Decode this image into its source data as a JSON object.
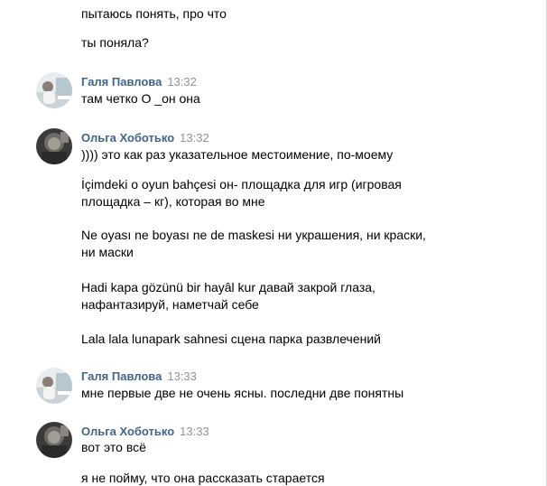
{
  "messages": {
    "pre1": "пытаюсь понять, про что",
    "pre2": "ты поняла?",
    "m1": {
      "author": "Галя Павлова",
      "time": "13:32",
      "text1": "там четко О _он она"
    },
    "m2": {
      "author": "Ольга Хоботько",
      "time": "13:32",
      "text1": ")))) это как раз указательное местоимение, по-моему",
      "text2": "İçimdeki o oyun bahçesi он- площадка для игр (игровая",
      "text3": "площадка – кг), которая во мне",
      "text4": "Ne oyası ne boyası ne de maskesi ни украшения, ни краски,",
      "text5": "ни маски",
      "text6": "Hadi kapa gözünü bir hayâl kur давай закрой глаза,",
      "text7": "нафантазируй, наметчай себе",
      "text8": "Lala lala lunapark sahnesi сцена парка развлечений"
    },
    "m3": {
      "author": "Галя Павлова",
      "time": "13:33",
      "text1": "мне первые две не очень ясны. последни две понятны"
    },
    "m4": {
      "author": "Ольга Хоботько",
      "time": "13:33",
      "text1": "вот это всё",
      "text2": "я не пойму, что она рассказать старается"
    }
  },
  "colors": {
    "author": "#42648b",
    "time": "#939393",
    "text": "#000000"
  },
  "icons": {
    "avatar_galya": "avatar-photo",
    "avatar_olga": "avatar-photo"
  }
}
